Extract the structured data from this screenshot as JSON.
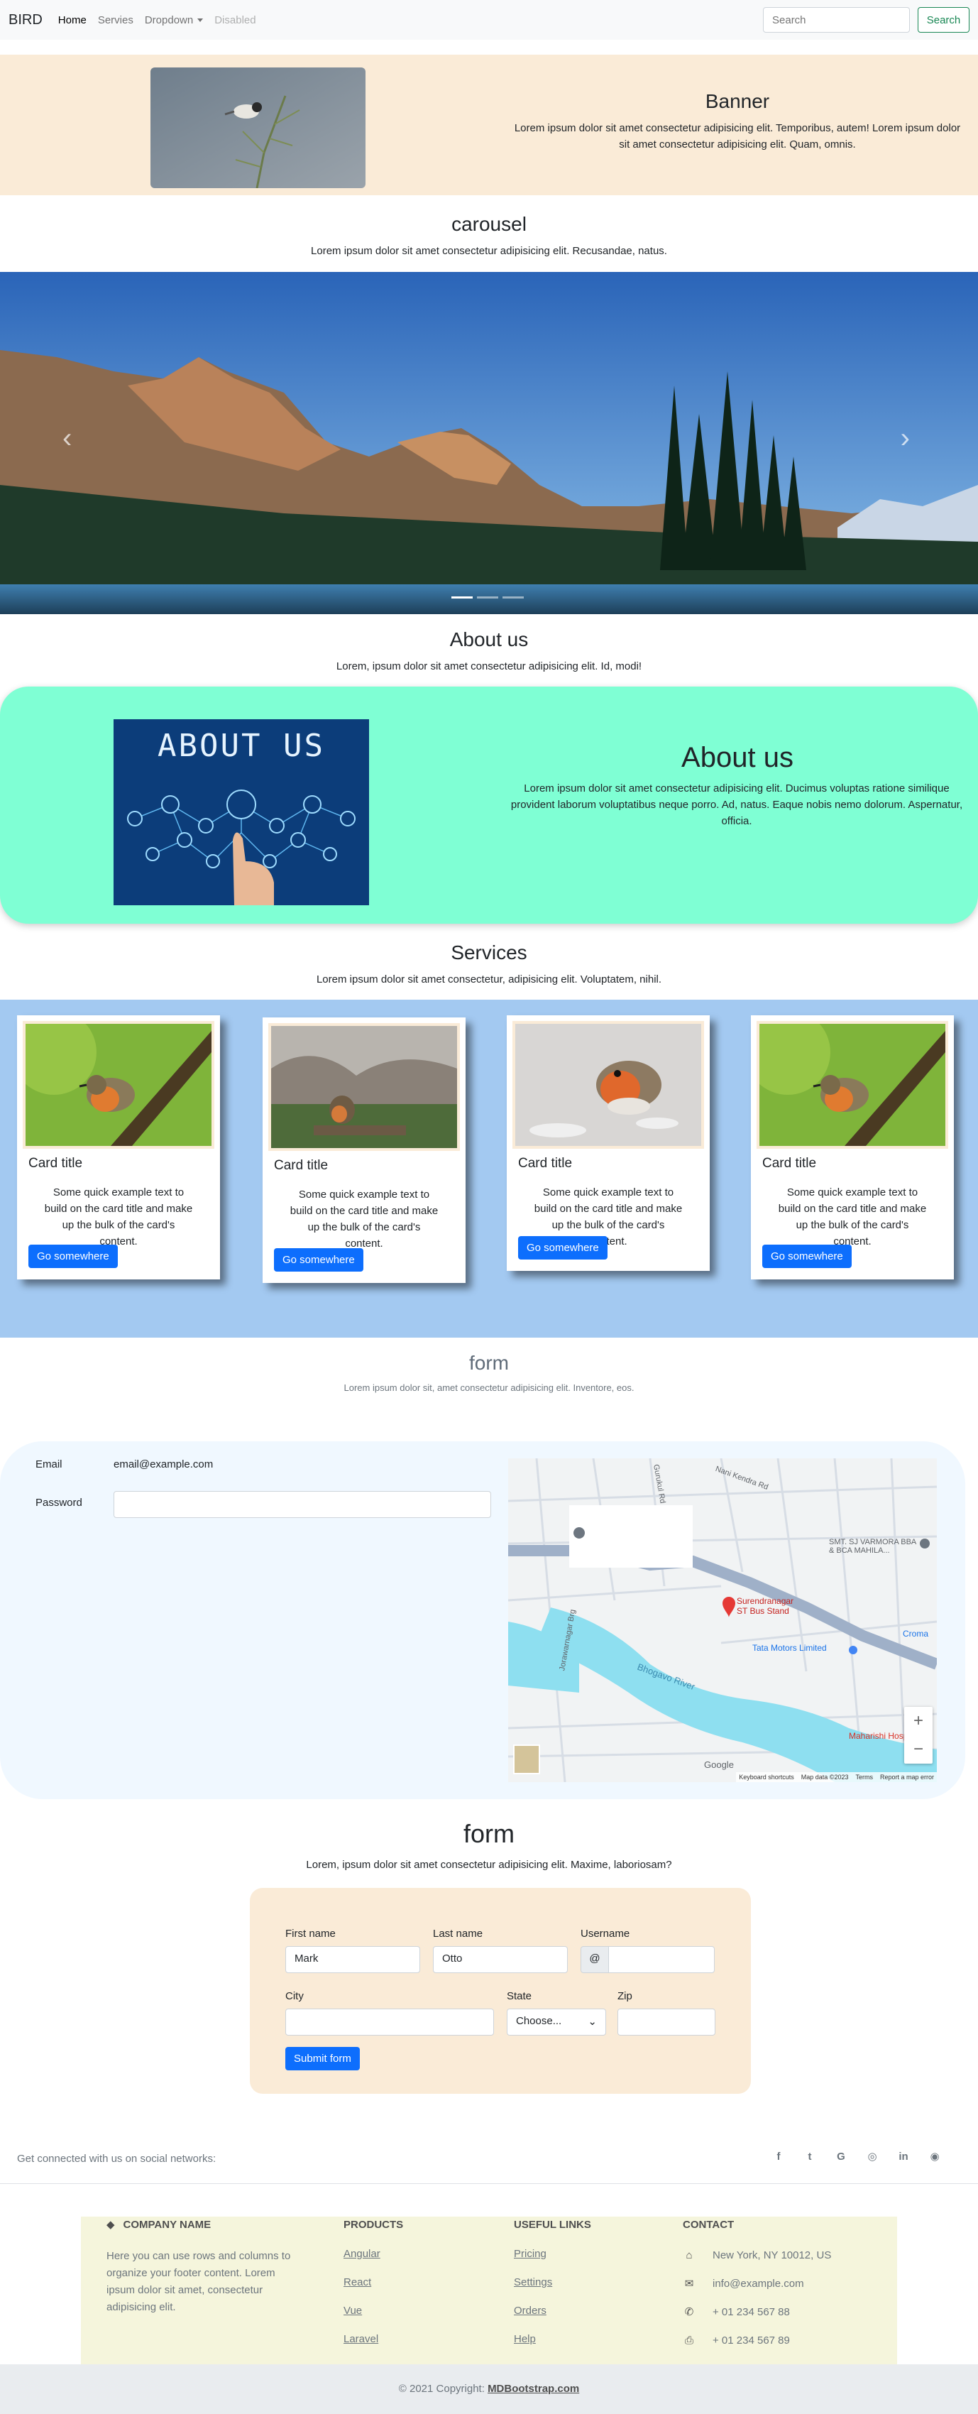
{
  "navbar": {
    "brand": "BIRD",
    "links": [
      {
        "label": "Home",
        "state": "active"
      },
      {
        "label": "Servies",
        "state": "normal"
      },
      {
        "label": "Dropdown",
        "state": "normal"
      },
      {
        "label": "Disabled",
        "state": "disabled"
      }
    ],
    "search_placeholder": "Search",
    "search_button": "Search"
  },
  "banner": {
    "title": "Banner",
    "text": "Lorem ipsum dolor sit amet consectetur adipisicing elit. Temporibus, autem! Lorem ipsum dolor sit amet consectetur adipisicing elit. Quam, omnis."
  },
  "carousel": {
    "title": "carousel",
    "subtitle": "Lorem ipsum dolor sit amet consectetur adipisicing elit. Recusandae, natus.",
    "prev_icon": "‹",
    "next_icon": "›",
    "active_slide": 1,
    "slide_count": 3
  },
  "about": {
    "section_title": "About us",
    "section_subtitle": "Lorem, ipsum dolor sit amet consectetur adipisicing elit. Id, modi!",
    "image_text": "ABOUT US",
    "title": "About us",
    "text": "Lorem ipsum dolor sit amet consectetur adipisicing elit. Ducimus voluptas ratione similique provident laborum voluptatibus neque porro. Ad, natus. Eaque nobis nemo dolorum. Aspernatur, officia."
  },
  "services": {
    "title": "Services",
    "subtitle": "Lorem ipsum dolor sit amet consectetur, adipisicing elit. Voluptatem, nihil.",
    "cards": [
      {
        "title": "Card title",
        "text": "Some quick example text to build on the card title and make up the bulk of the card's content.",
        "button": "Go somewhere"
      },
      {
        "title": "Card title",
        "text": "Some quick example text to build on the card title and make up the bulk of the card's content.",
        "button": "Go somewhere"
      },
      {
        "title": "Card title",
        "text": "Some quick example text to build on the card title and make up the bulk of the card's content.",
        "button": "Go somewhere"
      },
      {
        "title": "Card title",
        "text": "Some quick example text to build on the card title and make up the bulk of the card's content.",
        "button": "Go somewhere"
      }
    ]
  },
  "form1": {
    "title": "form",
    "subtitle": "Lorem ipsum dolor sit, amet consectetur adipisicing elit. Inventore, eos.",
    "email_label": "Email",
    "email_value": "email@example.com",
    "password_label": "Password",
    "map": {
      "labels": [
        "Nani Kendra Rd",
        "SMT. SJ VARMORA BBA & BCA MAHILA...",
        "Surendranagar ST Bus Stand",
        "Tata Motors Limited",
        "Bhogavo River",
        "Croma",
        "Maharishi Hospit",
        "Jorawarnagar Brg",
        "Gurukul Rd"
      ],
      "footer": [
        "Keyboard shortcuts",
        "Map data ©2023",
        "Terms",
        "Report a map error"
      ],
      "brand": "Google",
      "zoom_in": "+",
      "zoom_out": "−"
    }
  },
  "form2": {
    "title": "form",
    "subtitle": "Lorem, ipsum dolor sit amet consectetur adipisicing elit. Maxime, laboriosam?",
    "first_name_label": "First name",
    "first_name_value": "Mark",
    "last_name_label": "Last name",
    "last_name_value": "Otto",
    "username_label": "Username",
    "username_prefix": "@",
    "city_label": "City",
    "state_label": "State",
    "state_value": "Choose...",
    "zip_label": "Zip",
    "submit": "Submit form"
  },
  "social": {
    "text": "Get connected with us on social networks:",
    "icons": [
      "f",
      "t",
      "G",
      "◎",
      "in",
      "◉"
    ]
  },
  "footer": {
    "company_heading": "Company name",
    "company_text": "Here you can use rows and columns to organize your footer content. Lorem ipsum dolor sit amet, consectetur adipisicing elit.",
    "products_heading": "Products",
    "products": [
      "Angular",
      "React",
      "Vue",
      "Laravel"
    ],
    "links_heading": "Useful links",
    "links": [
      "Pricing",
      "Settings",
      "Orders",
      "Help"
    ],
    "contact_heading": "Contact",
    "contact": [
      {
        "icon": "home-icon",
        "text": "New York, NY 10012, US"
      },
      {
        "icon": "envelope-icon",
        "text": "info@example.com"
      },
      {
        "icon": "phone-icon",
        "text": "+ 01 234 567 88"
      },
      {
        "icon": "print-icon",
        "text": "+ 01 234 567 89"
      }
    ],
    "copyright_prefix": "© 2021 Copyright:",
    "copyright_link": "MDBootstrap.com"
  }
}
